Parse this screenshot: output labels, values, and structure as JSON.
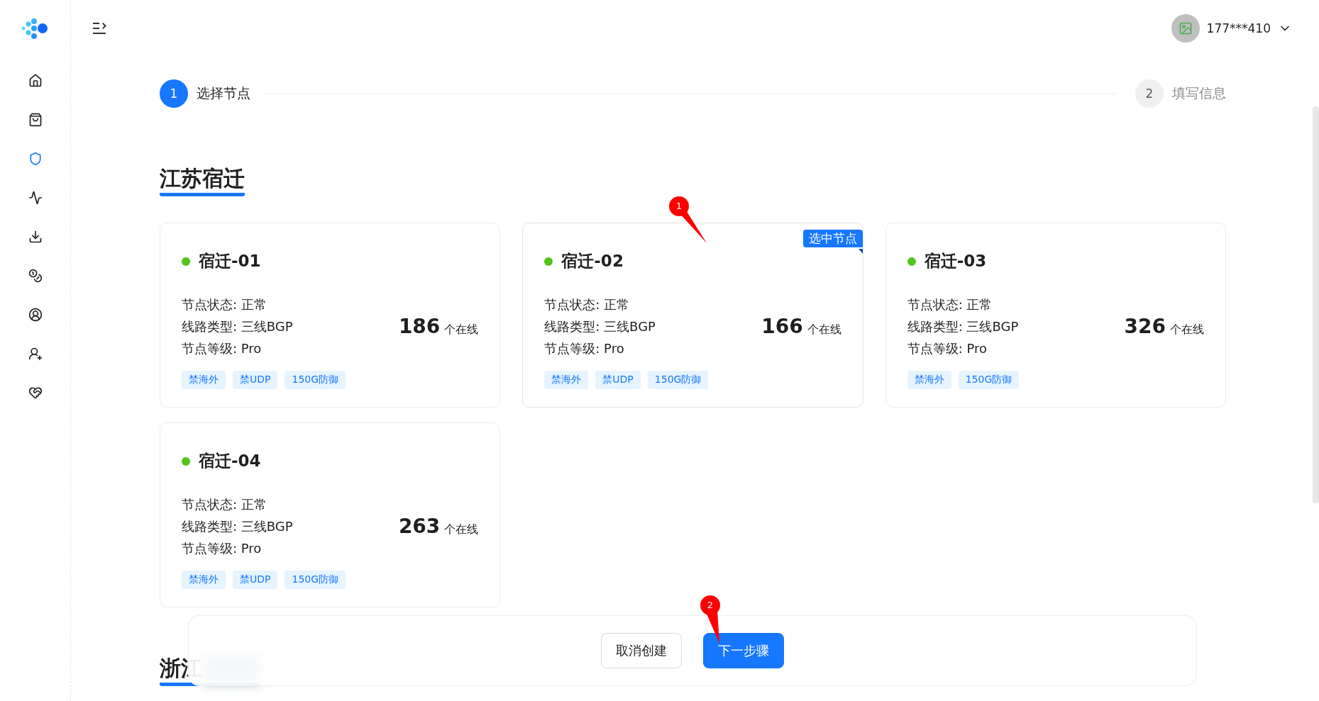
{
  "sidebar": {
    "items": [
      {
        "selected": false
      },
      {
        "selected": false
      },
      {
        "selected": true
      },
      {
        "selected": false
      },
      {
        "selected": false
      },
      {
        "selected": false
      },
      {
        "selected": false
      },
      {
        "selected": false
      },
      {
        "selected": false
      }
    ]
  },
  "header": {
    "user": "177***410"
  },
  "steps": [
    {
      "number": "1",
      "label": "选择节点",
      "selected": true
    },
    {
      "number": "2",
      "label": "填写信息",
      "selected": false
    }
  ],
  "selected_badge": "选中节点",
  "sections": [
    {
      "title": "江苏宿迁",
      "blurred": false,
      "nodes": [
        {
          "name": "宿迁-01",
          "color": "#52c41a",
          "selected": false,
          "info": [
            "节点状态: 正常",
            "线路类型: 三线BGP",
            "节点等级: Pro"
          ],
          "count": "186",
          "count_label": "个在线",
          "tags": [
            "禁海外",
            "禁UDP",
            "150G防御"
          ]
        },
        {
          "name": "宿迁-02",
          "color": "#52c41a",
          "selected": true,
          "info": [
            "节点状态: 正常",
            "线路类型: 三线BGP",
            "节点等级: Pro"
          ],
          "count": "166",
          "count_label": "个在线",
          "tags": [
            "禁海外",
            "禁UDP",
            "150G防御"
          ]
        },
        {
          "name": "宿迁-03",
          "color": "#52c41a",
          "selected": false,
          "info": [
            "节点状态: 正常",
            "线路类型: 三线BGP",
            "节点等级: Pro"
          ],
          "count": "326",
          "count_label": "个在线",
          "tags": [
            "禁海外",
            "150G防御"
          ]
        },
        {
          "name": "宿迁-04",
          "color": "#52c41a",
          "selected": false,
          "info": [
            "节点状态: 正常",
            "线路类型: 三线BGP",
            "节点等级: Pro"
          ],
          "count": "263",
          "count_label": "个在线",
          "tags": [
            "禁海外",
            "禁UDP",
            "150G防御"
          ]
        }
      ]
    },
    {
      "title": "浙江",
      "blurred": true
    }
  ],
  "footer": {
    "buttons": [
      {
        "label": "取消创建",
        "kind": "secondary"
      },
      {
        "label": "下一步骤",
        "kind": "primary"
      }
    ]
  },
  "annotations": [
    {
      "label": "1"
    },
    {
      "label": "2"
    }
  ]
}
